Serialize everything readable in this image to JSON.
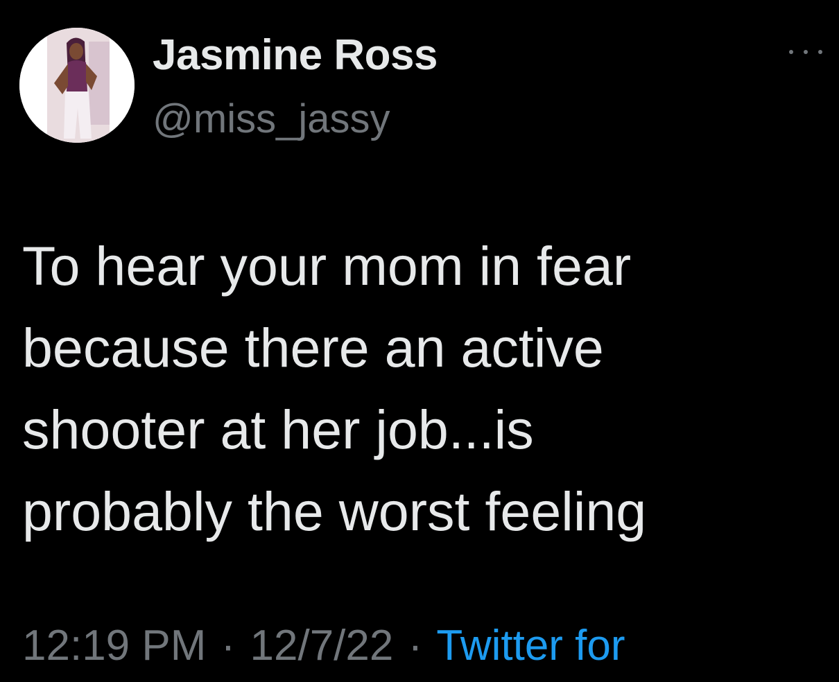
{
  "tweet": {
    "author": {
      "display_name": "Jasmine Ross",
      "handle": "@miss_jassy",
      "avatar_icon": "profile-photo"
    },
    "more_icon": "more-options-icon",
    "text_lines": [
      "To hear your mom in fear",
      "because there an active",
      "shooter at her job...is",
      "probably the worst feeling"
    ],
    "time": "12:19 PM",
    "separator": "·",
    "date": "12/7/22",
    "source": "Twitter for"
  },
  "colors": {
    "background": "#000000",
    "primary_text": "#e7e9ea",
    "secondary_text": "#71767b",
    "link": "#1d9bf0"
  }
}
